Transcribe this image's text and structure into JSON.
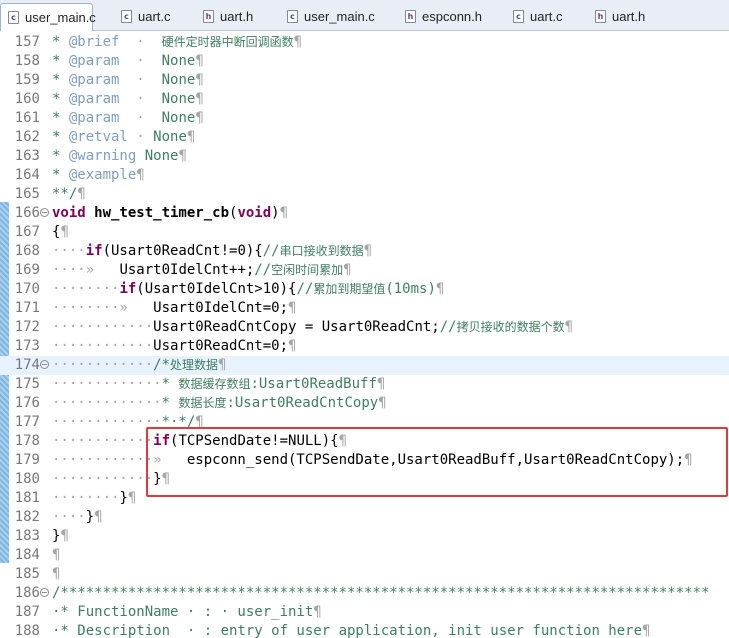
{
  "tabs": [
    {
      "label": "user_main.c",
      "icon": "c-file-icon",
      "active": true
    },
    {
      "label": "uart.c",
      "icon": "c-file-icon",
      "active": false
    },
    {
      "label": "uart.h",
      "icon": "h-file-icon",
      "active": false
    },
    {
      "label": "user_main.c",
      "icon": "c-file-icon",
      "active": false
    },
    {
      "label": "espconn.h",
      "icon": "h-file-icon",
      "active": false
    },
    {
      "label": "uart.c",
      "icon": "c-file-icon",
      "active": false
    },
    {
      "label": "uart.h",
      "icon": "h-file-icon",
      "active": false
    }
  ],
  "lines": [
    {
      "n": "157",
      "parts": [
        [
          "cm",
          "* "
        ],
        [
          "tag",
          "@brief"
        ],
        [
          "ws",
          "  ·  "
        ],
        [
          "cn",
          "硬件定时器中断回调函数"
        ],
        [
          "ws",
          "¶"
        ]
      ]
    },
    {
      "n": "158",
      "parts": [
        [
          "cm",
          "* "
        ],
        [
          "tag",
          "@param"
        ],
        [
          "ws",
          "  ·  "
        ],
        [
          "cm",
          "None"
        ],
        [
          "ws",
          "¶"
        ]
      ]
    },
    {
      "n": "159",
      "parts": [
        [
          "cm",
          "* "
        ],
        [
          "tag",
          "@param"
        ],
        [
          "ws",
          "  ·  "
        ],
        [
          "cm",
          "None"
        ],
        [
          "ws",
          "¶"
        ]
      ]
    },
    {
      "n": "160",
      "parts": [
        [
          "cm",
          "* "
        ],
        [
          "tag",
          "@param"
        ],
        [
          "ws",
          "  ·  "
        ],
        [
          "cm",
          "None"
        ],
        [
          "ws",
          "¶"
        ]
      ]
    },
    {
      "n": "161",
      "parts": [
        [
          "cm",
          "* "
        ],
        [
          "tag",
          "@param"
        ],
        [
          "ws",
          "  ·  "
        ],
        [
          "cm",
          "None"
        ],
        [
          "ws",
          "¶"
        ]
      ]
    },
    {
      "n": "162",
      "parts": [
        [
          "cm",
          "* "
        ],
        [
          "tag",
          "@retval"
        ],
        [
          "ws",
          " · "
        ],
        [
          "cm",
          "None"
        ],
        [
          "ws",
          "¶"
        ]
      ]
    },
    {
      "n": "163",
      "parts": [
        [
          "cm",
          "* "
        ],
        [
          "tag",
          "@warning"
        ],
        [
          "cm",
          " None"
        ],
        [
          "ws",
          "¶"
        ]
      ]
    },
    {
      "n": "164",
      "parts": [
        [
          "cm",
          "* "
        ],
        [
          "tag",
          "@example"
        ],
        [
          "ws",
          "¶"
        ]
      ]
    },
    {
      "n": "165",
      "parts": [
        [
          "cm",
          "**/"
        ],
        [
          "ws",
          "¶"
        ]
      ]
    },
    {
      "n": "166",
      "fold": true,
      "parts": [
        [
          "kw",
          "void"
        ],
        [
          "fn",
          " hw_test_timer_cb"
        ],
        [
          "",
          "("
        ],
        [
          "kw",
          "void"
        ],
        [
          "",
          ")"
        ],
        [
          "ws",
          "¶"
        ]
      ]
    },
    {
      "n": "167",
      "parts": [
        [
          "",
          "{"
        ],
        [
          "ws",
          "¶"
        ]
      ]
    },
    {
      "n": "168",
      "parts": [
        [
          "ws",
          "····"
        ],
        [
          "kw",
          "if"
        ],
        [
          "",
          "(Usart0ReadCnt!=0){"
        ],
        [
          "cm",
          "//"
        ],
        [
          "cn",
          "串口接收到数据"
        ],
        [
          "ws",
          "¶"
        ]
      ]
    },
    {
      "n": "169",
      "parts": [
        [
          "ws",
          "····»   "
        ],
        [
          "",
          "Usart0IdelCnt++;"
        ],
        [
          "cm",
          "//"
        ],
        [
          "cn",
          "空闲时间累加"
        ],
        [
          "ws",
          "¶"
        ]
      ]
    },
    {
      "n": "170",
      "parts": [
        [
          "ws",
          "········"
        ],
        [
          "kw",
          "if"
        ],
        [
          "",
          "(Usart0IdelCnt>10){"
        ],
        [
          "cm",
          "//"
        ],
        [
          "cn",
          "累加到期望值"
        ],
        [
          "cm",
          "(10ms)"
        ],
        [
          "ws",
          "¶"
        ]
      ]
    },
    {
      "n": "171",
      "parts": [
        [
          "ws",
          "········»   "
        ],
        [
          "",
          "Usart0IdelCnt=0;"
        ],
        [
          "ws",
          "¶"
        ]
      ]
    },
    {
      "n": "172",
      "parts": [
        [
          "ws",
          "············"
        ],
        [
          "",
          "Usart0ReadCntCopy = Usart0ReadCnt;"
        ],
        [
          "cm",
          "//"
        ],
        [
          "cn",
          "拷贝接收的数据个数"
        ],
        [
          "ws",
          "¶"
        ]
      ]
    },
    {
      "n": "173",
      "parts": [
        [
          "ws",
          "············"
        ],
        [
          "",
          "Usart0ReadCnt=0;"
        ],
        [
          "ws",
          "¶"
        ]
      ]
    },
    {
      "n": "174",
      "fold": true,
      "cur": true,
      "parts": [
        [
          "ws",
          "············"
        ],
        [
          "cm",
          "/*"
        ],
        [
          "cn",
          "处理数据"
        ],
        [
          "ws",
          "¶"
        ]
      ]
    },
    {
      "n": "175",
      "parts": [
        [
          "ws",
          "·············"
        ],
        [
          "cm",
          "* "
        ],
        [
          "cn",
          "数据缓存数组"
        ],
        [
          "cm",
          ":Usart0ReadBuff"
        ],
        [
          "ws",
          "¶"
        ]
      ]
    },
    {
      "n": "176",
      "parts": [
        [
          "ws",
          "·············"
        ],
        [
          "cm",
          "* "
        ],
        [
          "cn",
          "数据长度"
        ],
        [
          "cm",
          ":Usart0ReadCntCopy"
        ],
        [
          "ws",
          "¶"
        ]
      ]
    },
    {
      "n": "177",
      "parts": [
        [
          "ws",
          "·············"
        ],
        [
          "cm",
          "*·*/"
        ],
        [
          "ws",
          "¶"
        ]
      ]
    },
    {
      "n": "178",
      "parts": [
        [
          "ws",
          "············"
        ],
        [
          "kw",
          "if"
        ],
        [
          "",
          "(TCPSendDate!=NULL){"
        ],
        [
          "ws",
          "¶"
        ]
      ]
    },
    {
      "n": "179",
      "parts": [
        [
          "ws",
          "············»   "
        ],
        [
          "",
          "espconn_send(TCPSendDate,Usart0ReadBuff,Usart0ReadCntCopy);"
        ],
        [
          "ws",
          "¶"
        ]
      ]
    },
    {
      "n": "180",
      "parts": [
        [
          "ws",
          "············"
        ],
        [
          "",
          "}"
        ],
        [
          "ws",
          "¶"
        ]
      ]
    },
    {
      "n": "181",
      "parts": [
        [
          "ws",
          "········"
        ],
        [
          "",
          "}"
        ],
        [
          "ws",
          "¶"
        ]
      ]
    },
    {
      "n": "182",
      "parts": [
        [
          "ws",
          "····"
        ],
        [
          "",
          "}"
        ],
        [
          "ws",
          "¶"
        ]
      ]
    },
    {
      "n": "183",
      "parts": [
        [
          "",
          "}"
        ],
        [
          "ws",
          "¶"
        ]
      ]
    },
    {
      "n": "184",
      "parts": [
        [
          "ws",
          "¶"
        ]
      ]
    },
    {
      "n": "185",
      "parts": [
        [
          "ws",
          "¶"
        ]
      ]
    },
    {
      "n": "186",
      "fold": true,
      "parts": [
        [
          "cm",
          "/*****************************************************************************"
        ]
      ]
    },
    {
      "n": "187",
      "parts": [
        [
          "cm",
          "·* FunctionName · : · user_init"
        ],
        [
          "ws",
          "¶"
        ]
      ]
    },
    {
      "n": "188",
      "parts": [
        [
          "cm",
          "·* Description  · : entry of user application, init user function here"
        ],
        [
          "ws",
          "¶"
        ]
      ]
    }
  ],
  "highlight_note": "",
  "colors": {
    "accent": "#e23a3a",
    "changebar": "#7fb6e0"
  }
}
